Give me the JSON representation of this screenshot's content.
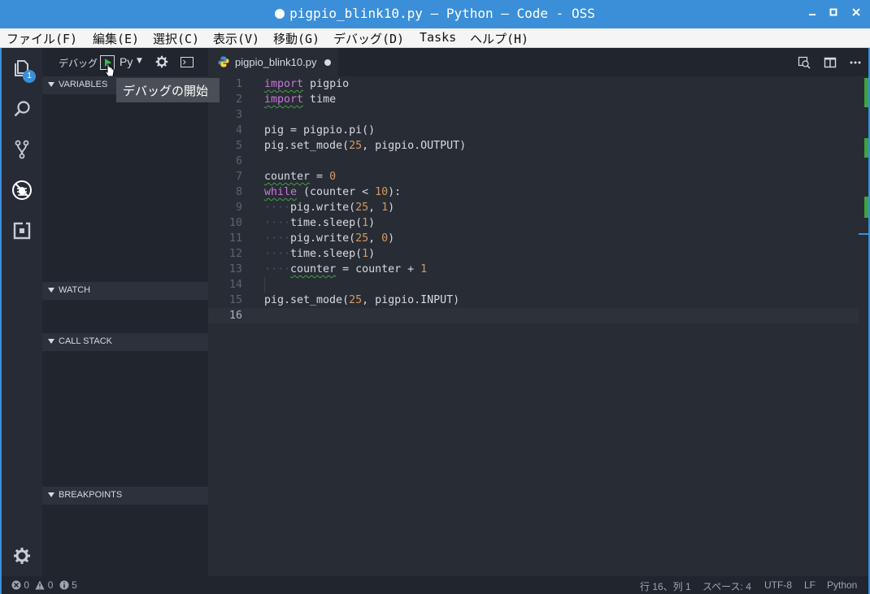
{
  "window": {
    "title": "pigpio_blink10.py — Python — Code - OSS"
  },
  "menu": {
    "items": [
      "ファイル(F)",
      "編集(E)",
      "選択(C)",
      "表示(V)",
      "移動(G)",
      "デバッグ(D)",
      "Tasks",
      "ヘルプ(H)"
    ]
  },
  "activity_bar": {
    "explorer_badge": "1",
    "icons": [
      "files-icon",
      "search-icon",
      "source-control-icon",
      "debug-icon",
      "extensions-icon",
      "settings-gear-icon"
    ]
  },
  "debug_toolbar": {
    "label": "デバッグ",
    "configuration": "Py",
    "tooltip": "デバッグの開始"
  },
  "sidebar_sections": {
    "variables": "VARIABLES",
    "watch": "WATCH",
    "call_stack": "CALL STACK",
    "breakpoints": "BREAKPOINTS"
  },
  "editor": {
    "tab_name": "pigpio_blink10.py",
    "line_numbers": [
      "1",
      "2",
      "3",
      "4",
      "5",
      "6",
      "7",
      "8",
      "9",
      "10",
      "11",
      "12",
      "13",
      "14",
      "15",
      "16"
    ]
  },
  "status_bar": {
    "errors": "0",
    "warnings": "0",
    "infos": "5",
    "cursor_position": "行 16、列 1",
    "indentation": "スペース: 4",
    "encoding": "UTF-8",
    "eol": "LF",
    "language": "Python"
  },
  "colors": {
    "title_bar": "#3b8fd8",
    "activity_bar": "#262b35",
    "sidebar": "#21252d",
    "editor": "#282c34",
    "keyword": "#c678dd",
    "number": "#d19a66",
    "start_debug": "#3fb950",
    "warning_squiggle": "#3fa33f"
  }
}
